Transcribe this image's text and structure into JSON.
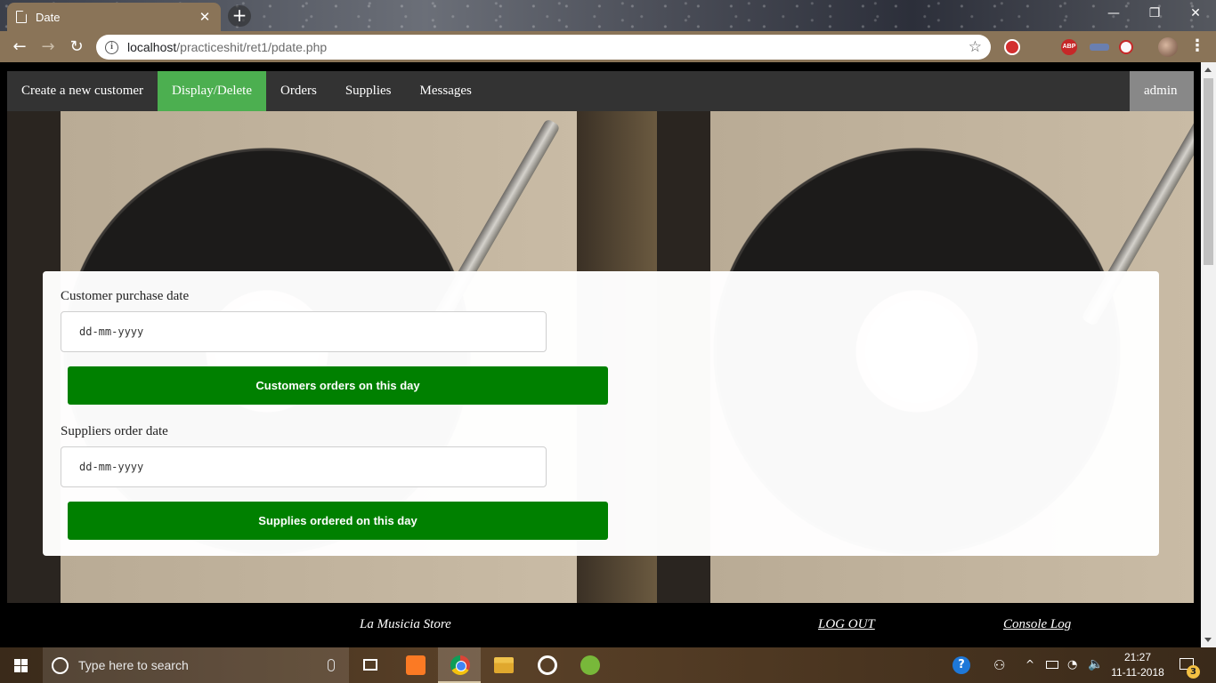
{
  "browser": {
    "tab_title": "Date",
    "tab_close": "✕",
    "new_tab": "+",
    "window_controls": {
      "minimize": "—",
      "restore": "❐",
      "close": "✕"
    },
    "back": "←",
    "forward": "→",
    "reload": "↻",
    "url_host": "localhost",
    "url_path": "/practiceshit/ret1/pdate.php",
    "bookmark_star": "☆",
    "menu": "⋮",
    "extensions": [
      "ublock-icon",
      "adblock-plus-icon",
      "extension-icon",
      "extension-icon",
      "profile-avatar"
    ],
    "abp_label": "ABP"
  },
  "nav": {
    "items": [
      {
        "label": "Create a new customer",
        "active": false
      },
      {
        "label": "Display/Delete",
        "active": true
      },
      {
        "label": "Orders",
        "active": false
      },
      {
        "label": "Supplies",
        "active": false
      },
      {
        "label": "Messages",
        "active": false
      }
    ],
    "admin_label": "admin",
    "active_color": "#4caf50"
  },
  "form": {
    "customer_label": "Customer purchase date",
    "customer_placeholder": "dd-mm-yyyy",
    "customer_button": "Customers orders on this day",
    "supplier_label": "Suppliers order date",
    "supplier_placeholder": "dd-mm-yyyy",
    "supplier_button": "Supplies ordered on this day",
    "button_color": "#008000"
  },
  "footer": {
    "store": "La Musicia Store",
    "logout": "LOG OUT",
    "console": "Console Log"
  },
  "taskbar": {
    "search_placeholder": "Type here to search",
    "apps": [
      "task-view-icon",
      "xampp-icon",
      "chrome-icon",
      "file-explorer-icon",
      "app-icon",
      "utorrent-icon"
    ],
    "help": "?",
    "people": "⚇",
    "chevron": "^",
    "wifi": "◔",
    "volume": "🔈",
    "time": "21:27",
    "date": "11-11-2018",
    "notification_count": "3"
  }
}
